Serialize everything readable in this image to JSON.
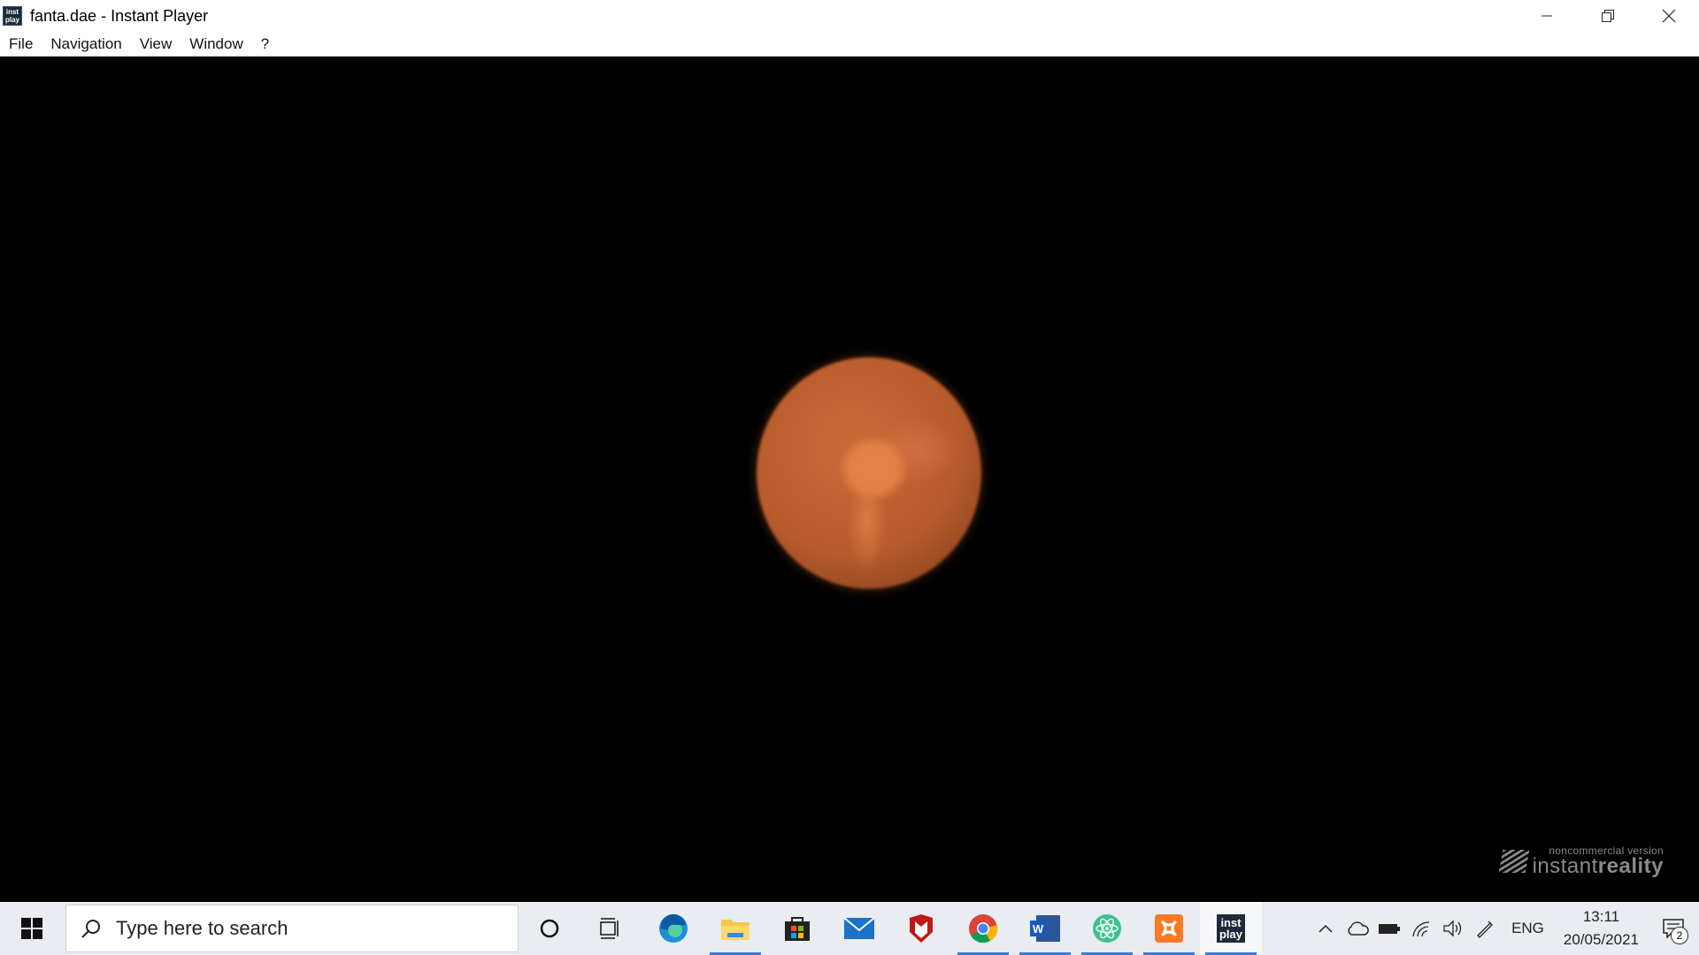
{
  "window": {
    "title": "fanta.dae - Instant Player",
    "app_icon_text_top": "inst",
    "app_icon_text_bottom": "play",
    "controls": [
      "minimize-icon",
      "restore-icon",
      "close-icon"
    ]
  },
  "menubar": {
    "items": [
      "File",
      "Navigation",
      "View",
      "Window",
      "?"
    ]
  },
  "viewport": {
    "background_color": "#000000",
    "object": "orange-sphere",
    "object_color": "#e07f46"
  },
  "watermark": {
    "line1": "noncommercial version",
    "line2_regular": "instant",
    "line2_bold": "reality"
  },
  "taskbar": {
    "search_placeholder": "Type here to search",
    "pinned": [
      {
        "name": "cortana-icon",
        "running": false
      },
      {
        "name": "task-view-icon",
        "running": false
      },
      {
        "name": "edge-icon",
        "running": false
      },
      {
        "name": "file-explorer-icon",
        "running": true
      },
      {
        "name": "microsoft-store-icon",
        "running": false
      },
      {
        "name": "mail-icon",
        "running": false
      },
      {
        "name": "mcafee-icon",
        "running": false
      },
      {
        "name": "chrome-icon",
        "running": true
      },
      {
        "name": "word-icon",
        "running": true
      },
      {
        "name": "atom-icon",
        "running": true
      },
      {
        "name": "xampp-icon",
        "running": true
      },
      {
        "name": "instant-player-icon",
        "running": true
      }
    ],
    "instant_player_icon_top": "inst",
    "instant_player_icon_bottom": "play",
    "word_icon_letter": "W",
    "tray": {
      "language": "ENG",
      "time": "13:11",
      "date": "20/05/2021",
      "notification_count": "2"
    }
  }
}
